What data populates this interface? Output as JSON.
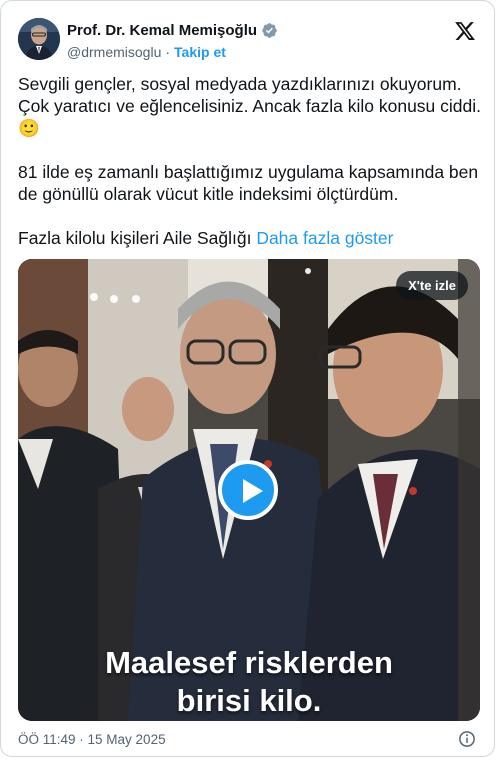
{
  "author": {
    "name": "Prof. Dr. Kemal Memişoğlu",
    "handle": "@drmemisoglu",
    "separator": "·",
    "follow_label": "Takip et"
  },
  "tweet": {
    "paragraph1": "Sevgili gençler, sosyal medyada yazdıklarınızı okuyorum. Çok yaratıcı ve eğlencelisiniz. Ancak fazla kilo konusu ciddi. 🙂",
    "paragraph2": "81 ilde eş zamanlı başlattığımız uygulama kapsamında ben de gönüllü olarak vücut kitle indeksimi ölçtürdüm.",
    "paragraph3": "Fazla kilolu kişileri Aile Sağlığı",
    "show_more": "Daha fazla göster"
  },
  "media": {
    "watch_on_x": "X'te izle",
    "subtitle_line1": "Maalesef risklerden",
    "subtitle_line2": "birisi kilo."
  },
  "footer": {
    "timestamp": "ÖÖ 11:49 · 15 May 2025"
  },
  "colors": {
    "accent": "#1d9bf0",
    "secondary_text": "#536471",
    "border": "#cfd9de"
  },
  "icons": {
    "verified": "verified-badge-icon",
    "x_logo": "x-logo-icon",
    "play": "play-icon",
    "info": "info-icon"
  }
}
